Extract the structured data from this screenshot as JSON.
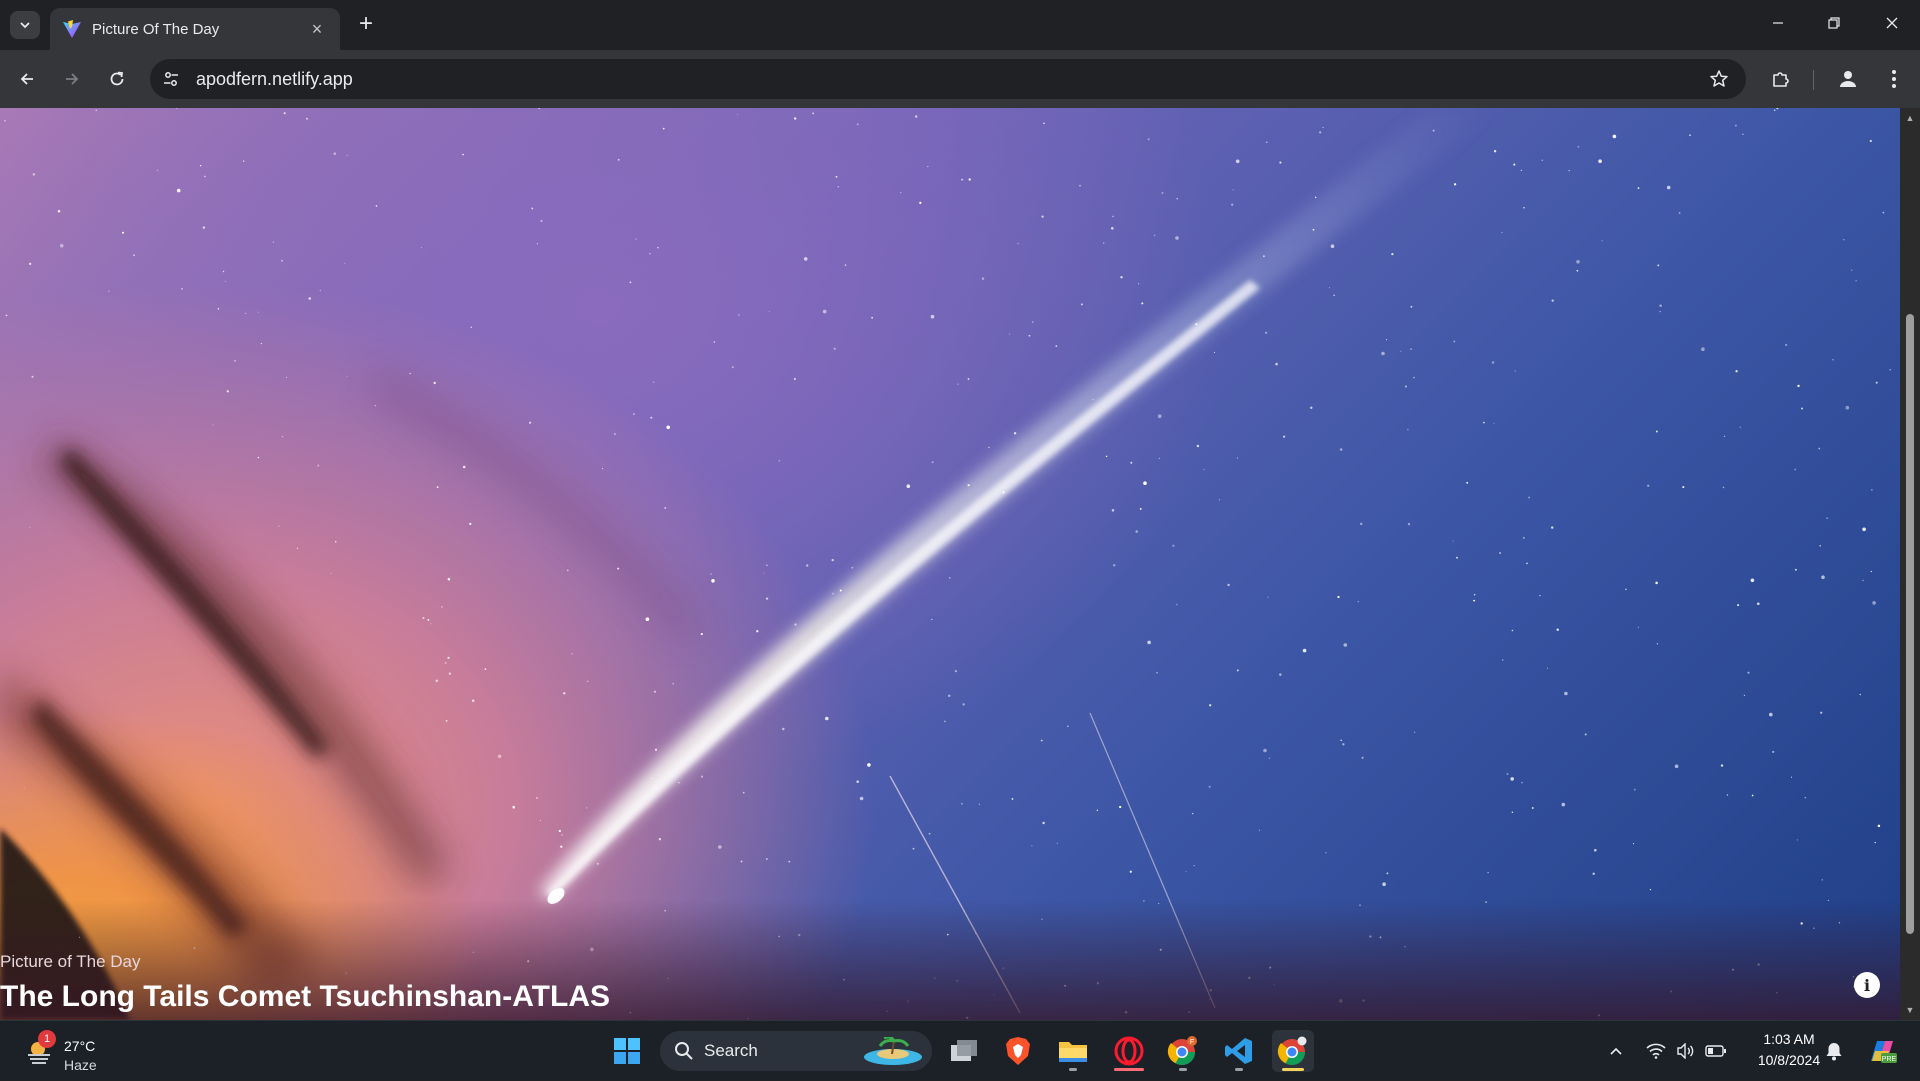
{
  "browser": {
    "tab": {
      "title": "Picture Of The Day",
      "close_symbol": "×"
    },
    "new_tab_symbol": "+",
    "omnibox": {
      "url": "apodfern.netlify.app"
    }
  },
  "page": {
    "hero": {
      "subtitle": "Picture of The Day",
      "title": "The Long Tails Comet Tsuchinshan-ATLAS",
      "info_symbol": "i"
    }
  },
  "taskbar": {
    "weather": {
      "temp": "27°C",
      "condition": "Haze",
      "badge": "1"
    },
    "search_label": "Search",
    "clock": {
      "time": "1:03 AM",
      "date": "10/8/2024"
    },
    "apps": [
      "start-icon",
      "task-view-icon",
      "brave-icon",
      "file-explorer-icon",
      "opera-icon",
      "chrome-profile-icon",
      "vscode-icon",
      "chrome-icon"
    ]
  },
  "colors": {
    "chrome_dark": "#202124",
    "toolbar": "#35363a",
    "taskbar": "#1c2128",
    "sky_blue": "#1f3f87",
    "sunset_orange": "#f2a13c"
  }
}
